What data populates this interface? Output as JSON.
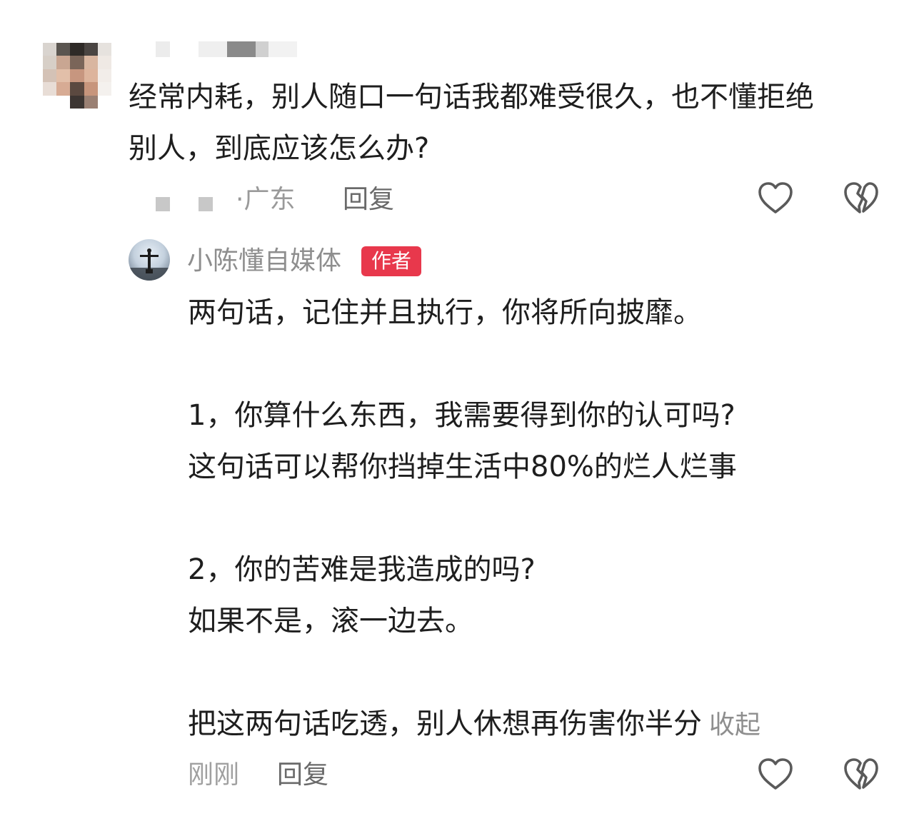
{
  "comment": {
    "text_line1": "经常内耗，别人随口一句话我都难受很久，也不懂拒绝",
    "text_line2": "别人，到底应该怎么办?",
    "location": "·广东",
    "reply_label": "回复",
    "like_icon": "heart-outline-icon",
    "dislike_icon": "broken-heart-icon"
  },
  "author_reply": {
    "author_name": "小陈懂自媒体",
    "badge": "作者",
    "lines": [
      "两句话，记住并且执行，你将所向披靡。",
      "",
      "1，你算什么东西，我需要得到你的认可吗?",
      "这句话可以帮你挡掉生活中80%的烂人烂事",
      "",
      "2，你的苦难是我造成的吗?",
      "如果不是，滚一边去。",
      "",
      "把这两句话吃透，别人休想再伤害你半分"
    ],
    "collapse_label": "收起",
    "time": "刚刚",
    "reply_label": "回复",
    "like_icon": "heart-outline-icon",
    "dislike_icon": "broken-heart-icon"
  },
  "colors": {
    "text": "#1e1e1e",
    "secondary_text": "#8e8e8e",
    "badge_background": "#e8384c",
    "badge_text": "#ffffff",
    "icon_stroke": "#5a5a5a"
  }
}
